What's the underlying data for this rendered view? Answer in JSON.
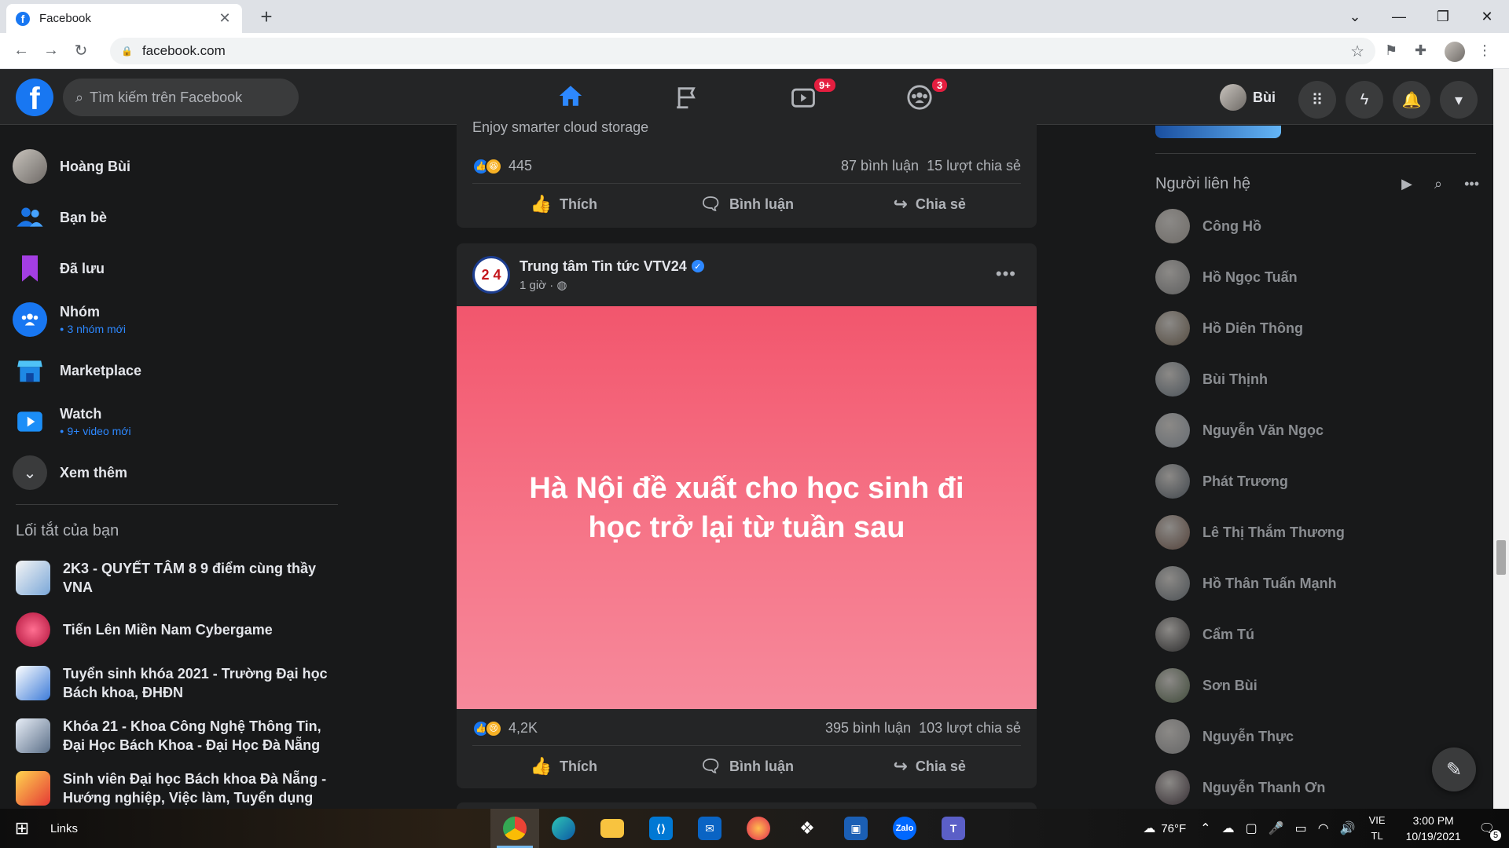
{
  "browser": {
    "tab_title": "Facebook",
    "url": "facebook.com",
    "new_tab": "+",
    "tab_close": "✕"
  },
  "header": {
    "search_placeholder": "Tìm kiếm trên Facebook",
    "profile_name": "Bùi",
    "watch_badge": "9+",
    "groups_badge": "3"
  },
  "left_nav": {
    "items": [
      {
        "label": "Hoàng Bùi",
        "sub": ""
      },
      {
        "label": "Bạn bè",
        "sub": ""
      },
      {
        "label": "Đã lưu",
        "sub": ""
      },
      {
        "label": "Nhóm",
        "sub": "3 nhóm mới"
      },
      {
        "label": "Marketplace",
        "sub": ""
      },
      {
        "label": "Watch",
        "sub": "9+ video mới"
      },
      {
        "label": "Xem thêm",
        "sub": ""
      }
    ],
    "shortcuts_title": "Lối tắt của bạn",
    "shortcuts": [
      {
        "label": "2K3 - QUYẾT TÂM 8 9 điểm cùng thầy VNA"
      },
      {
        "label": "Tiến Lên Miền Nam Cybergame"
      },
      {
        "label": "Tuyển sinh khóa 2021 - Trường Đại học Bách khoa, ĐHĐN"
      },
      {
        "label": "Khóa 21 - Khoa Công Nghệ Thông Tin, Đại Học Bách Khoa - Đại Học Đà Nẵng"
      },
      {
        "label": "Sinh viên Đại học Bách khoa Đà Nẵng - Hướng nghiệp, Việc làm, Tuyển dụng"
      }
    ]
  },
  "feed": {
    "post1": {
      "caption": "Enjoy smarter cloud storage",
      "reactions": "445",
      "comments": "87 bình luận",
      "shares": "15 lượt chia sẻ",
      "like": "Thích",
      "comment": "Bình luận",
      "share": "Chia sẻ"
    },
    "post2": {
      "page_name": "Trung tâm Tin tức VTV24",
      "time": "1 giờ · ",
      "avatar_text": "2 4",
      "poster_text": "Hà Nội đề xuất cho học sinh đi học trở lại từ tuần sau",
      "reactions": "4,2K",
      "comments": "395 bình luận",
      "shares": "103 lượt chia sẻ",
      "like": "Thích",
      "comment": "Bình luận",
      "share": "Chia sẻ"
    }
  },
  "contacts": {
    "title": "Người liên hệ",
    "list": [
      "Công Hồ",
      "Hồ Ngọc Tuấn",
      "Hồ Diên Thông",
      "Bùi Thịnh",
      "Nguyễn Văn Ngọc",
      "Phát Trương",
      "Lê Thị Thắm Thương",
      "Hồ Thân Tuấn Mạnh",
      "Cẩm Tú",
      "Sơn Bùi",
      "Nguyễn Thực",
      "Nguyễn Thanh Ơn"
    ]
  },
  "taskbar": {
    "links": "Links",
    "weather": "76°F",
    "lang_top": "VIE",
    "lang_bottom": "TL",
    "time": "3:00 PM",
    "date": "10/19/2021",
    "notif_count": "5",
    "zalo": "Zalo"
  },
  "colors": {
    "accent": "#2d88ff",
    "fb_blue": "#1877f2",
    "badge_red": "#e41e3f",
    "bg_dark": "#18191a",
    "card": "#242526"
  },
  "icons": [
    "home-icon",
    "pages-flag-icon",
    "watch-icon",
    "groups-icon",
    "menu-grid-icon",
    "messenger-icon",
    "bell-icon",
    "caret-down-icon",
    "compose-icon"
  ]
}
